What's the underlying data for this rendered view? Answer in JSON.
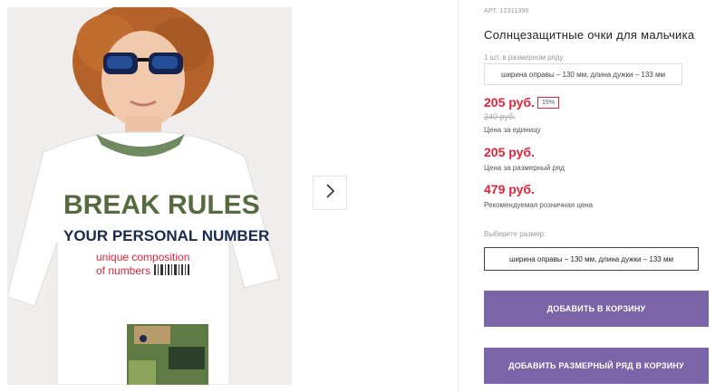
{
  "product": {
    "article": "АРТ. 12311396",
    "title": "Солнцезащитные очки для мальчика",
    "pack_label": "1 шт. в размерном ряду",
    "pack_value": "ширина оправы – 130 мм, длина дужки – 133 мм"
  },
  "prices": {
    "unit_price": "205 руб.",
    "discount": "15%",
    "old_price": "240 руб.",
    "unit_caption": "Цена за единицу",
    "row_price": "205 руб.",
    "row_caption": "Цена за размерный ряд",
    "retail_price": "479 руб.",
    "retail_caption": "Рекомендуемая розничная цена"
  },
  "size": {
    "label": "Выберите размер:",
    "selected": "ширина оправы – 130 мм, длина дужки – 133 мм"
  },
  "buttons": {
    "add_to_cart": "ДОБАВИТЬ В КОРЗИНУ",
    "add_row_to_cart": "ДОБАВИТЬ РАЗМЕРНЫЙ РЯД В КОРЗИНУ"
  },
  "photo": {
    "shirt_line1": "BREAK RULES",
    "shirt_line2": "YOUR PERSONAL NUMBER",
    "shirt_line3": "unique composition",
    "shirt_line4": "of numbers"
  },
  "colors": {
    "accent": "#7b64a8",
    "price": "#e0243a"
  },
  "icons": {
    "next": "chevron-right-icon"
  }
}
